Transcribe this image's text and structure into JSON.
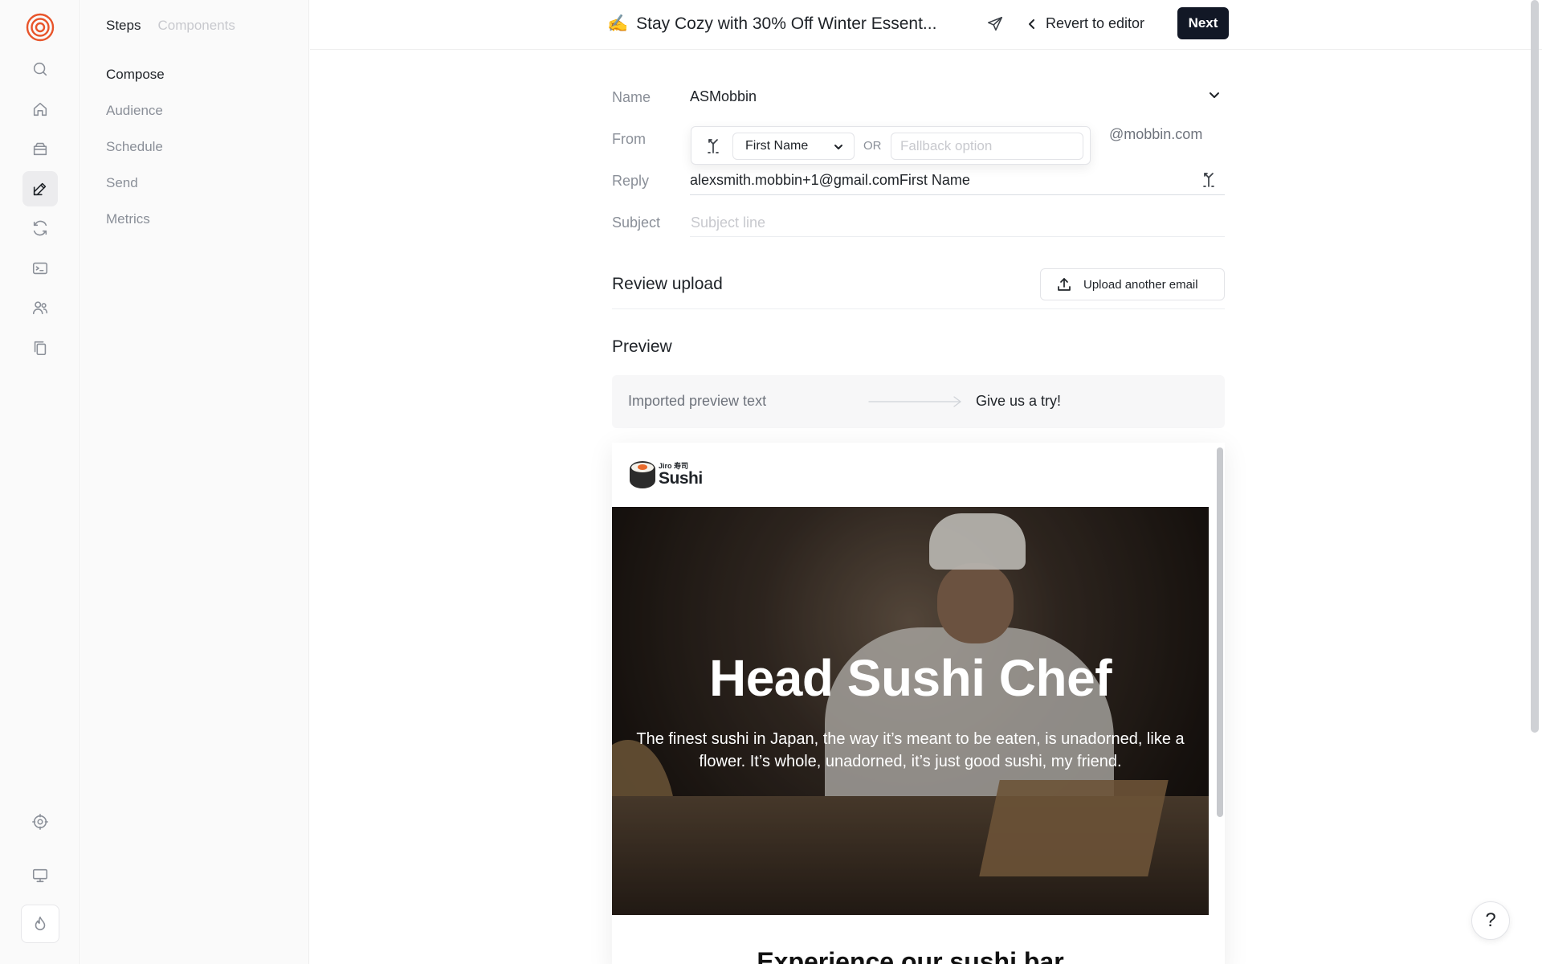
{
  "rail": {
    "items": [
      "search",
      "home",
      "inbox",
      "compose",
      "refresh",
      "terminal",
      "users",
      "copy",
      "settings",
      "monitor",
      "fire"
    ]
  },
  "steps": {
    "tabs": [
      "Steps",
      "Components"
    ],
    "items": [
      "Compose",
      "Audience",
      "Schedule",
      "Send",
      "Metrics"
    ]
  },
  "header": {
    "emoji": "✍️",
    "title": "Stay Cozy with 30% Off Winter Essent...",
    "revert_label": "Revert to editor",
    "next_label": "Next"
  },
  "form": {
    "name_label": "Name",
    "name_value": "ASMobbin",
    "from_label": "From",
    "from_select_value": "First Name",
    "or_label": "OR",
    "fallback_placeholder": "Fallback option",
    "from_domain": "@mobbin.com",
    "reply_label": "Reply",
    "reply_email": "alexsmith.mobbin+1@gmail.com",
    "reply_tag": "First Name",
    "subject_label": "Subject",
    "subject_placeholder": "Subject line"
  },
  "review": {
    "title": "Review upload",
    "upload_label": "Upload another email"
  },
  "preview": {
    "title": "Preview",
    "preview_text": "Imported preview text",
    "preview_cta": "Give us a try!"
  },
  "email": {
    "logo_small": "Jiro 寿司",
    "logo_big": "Sushi",
    "hero_title": "Head Sushi Chef",
    "hero_body": "The finest sushi in Japan, the way it’s meant to be eaten, is unadorned, like a flower. It’s whole, unadorned, it’s just good sushi, my friend.",
    "next_heading": "Experience our sushi bar"
  },
  "help": {
    "label": "?"
  },
  "colors": {
    "accent": "#e8542a",
    "primary_button": "#121826"
  }
}
